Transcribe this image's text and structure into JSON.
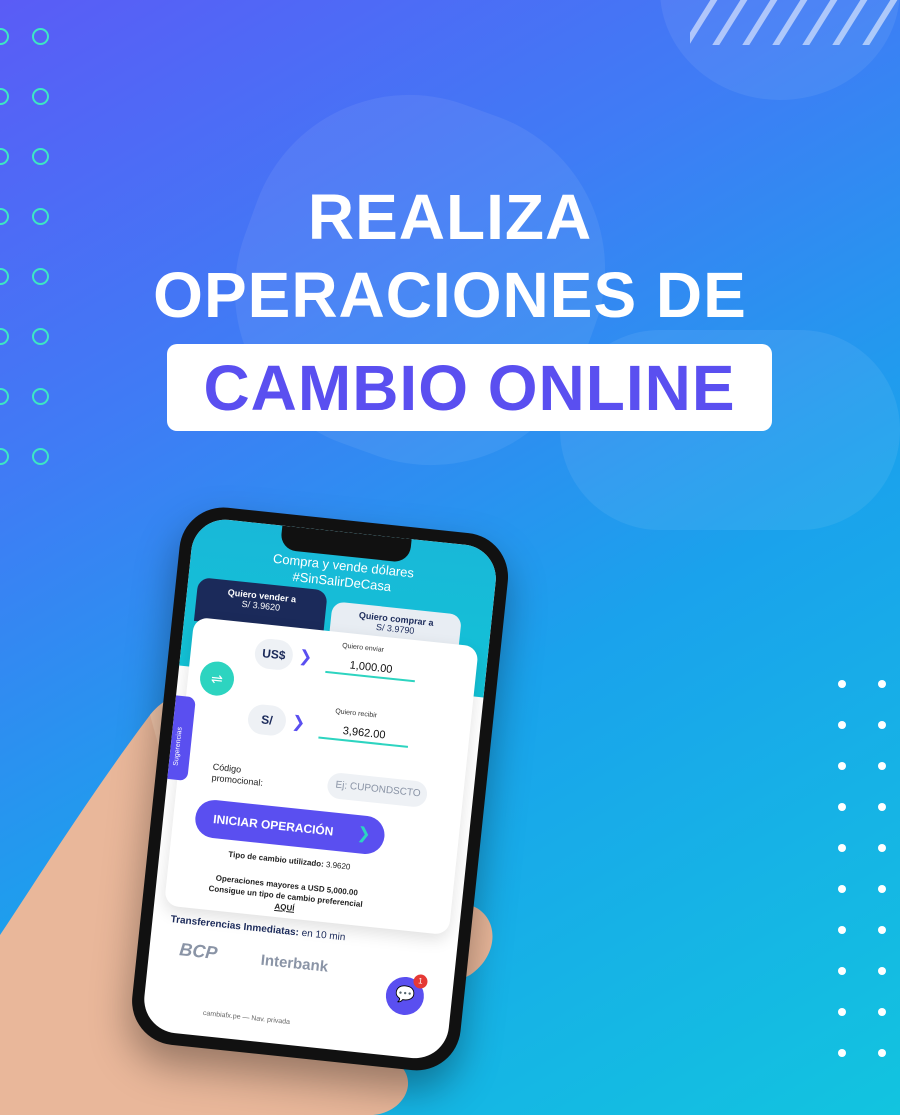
{
  "headline": {
    "line1": "REALIZA",
    "line2": "OPERACIONES DE",
    "highlight": "CAMBIO ONLINE"
  },
  "colors": {
    "accent": "#5a4ff0",
    "teal": "#2dd4c0",
    "navy": "#1b2a5a",
    "bg_start": "#5a5cf6",
    "bg_end": "#12c4df"
  },
  "phone": {
    "header_line1": "Compra y vende dólares",
    "header_line2": "#SinSalirDeCasa",
    "tab_sell": {
      "label": "Quiero vender a",
      "rate": "S/ 3.9620"
    },
    "tab_buy": {
      "label": "Quiero comprar a",
      "rate": "S/ 3.9790"
    },
    "send": {
      "currency": "US$",
      "label": "Quiero enviar",
      "amount": "1,000.00"
    },
    "receive": {
      "currency": "S/",
      "label": "Quiero recibir",
      "amount": "3,962.00"
    },
    "promo_label": "Código promocional:",
    "promo_placeholder": "Ej: CUPONDSCTO",
    "cta": "INICIAR OPERACIÓN",
    "rate_used_label": "Tipo de cambio utilizado:",
    "rate_used_value": "3.9620",
    "note_line1": "Operaciones mayores a USD 5,000.00",
    "note_line2": "Consigue un tipo de cambio preferencial",
    "note_link": "AQUÍ",
    "transfers_label": "Transferencias Inmediatas:",
    "transfers_time": "en 10 min",
    "banks": [
      "BCP",
      "Interbank"
    ],
    "url": "cambiafx.pe — Nav. privada",
    "chat_badge": "1",
    "side_tab": "Sugerencias"
  }
}
